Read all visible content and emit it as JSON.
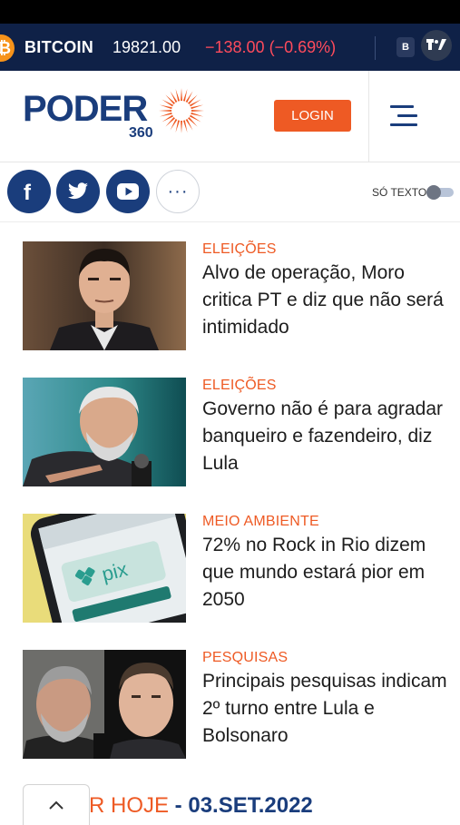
{
  "ticker": {
    "coin_icon": "bitcoin-icon",
    "name": "BITCOIN",
    "price": "19821.00",
    "change": "−138.00 (−0.69%)",
    "exchange_badge": "B",
    "brand_badge": "TV"
  },
  "header": {
    "logo_word": "PODER",
    "logo_sub": "360",
    "login_label": "LOGIN",
    "menu_icon": "hamburger-icon"
  },
  "social": {
    "buttons": [
      "facebook-icon",
      "twitter-icon",
      "youtube-icon",
      "more-icon"
    ],
    "more_label": "···",
    "text_only_label": "SÓ TEXTO",
    "text_only_enabled": false
  },
  "articles": [
    {
      "category": "ELEIÇÕES",
      "headline": "Alvo de operação, Moro critica PT e diz que não será intimidado"
    },
    {
      "category": "ELEIÇÕES",
      "headline": "Governo não é para agradar banqueiro e fazendeiro, diz Lula"
    },
    {
      "category": "MEIO AMBIENTE",
      "headline": "72% no Rock in Rio dizem que mundo estará pior em 2050"
    },
    {
      "category": "PESQUISAS",
      "headline": "Principais pesquisas indicam 2º turno entre Lula e Bolsonaro"
    }
  ],
  "edition": {
    "title_fragment": "R HOJE",
    "separator": " - ",
    "date": "03.SET.2022"
  },
  "colors": {
    "brand_navy": "#1a3d7c",
    "accent_orange": "#ee5a24",
    "ticker_bg": "#0f2147",
    "ticker_negative": "#ff4b5c"
  }
}
